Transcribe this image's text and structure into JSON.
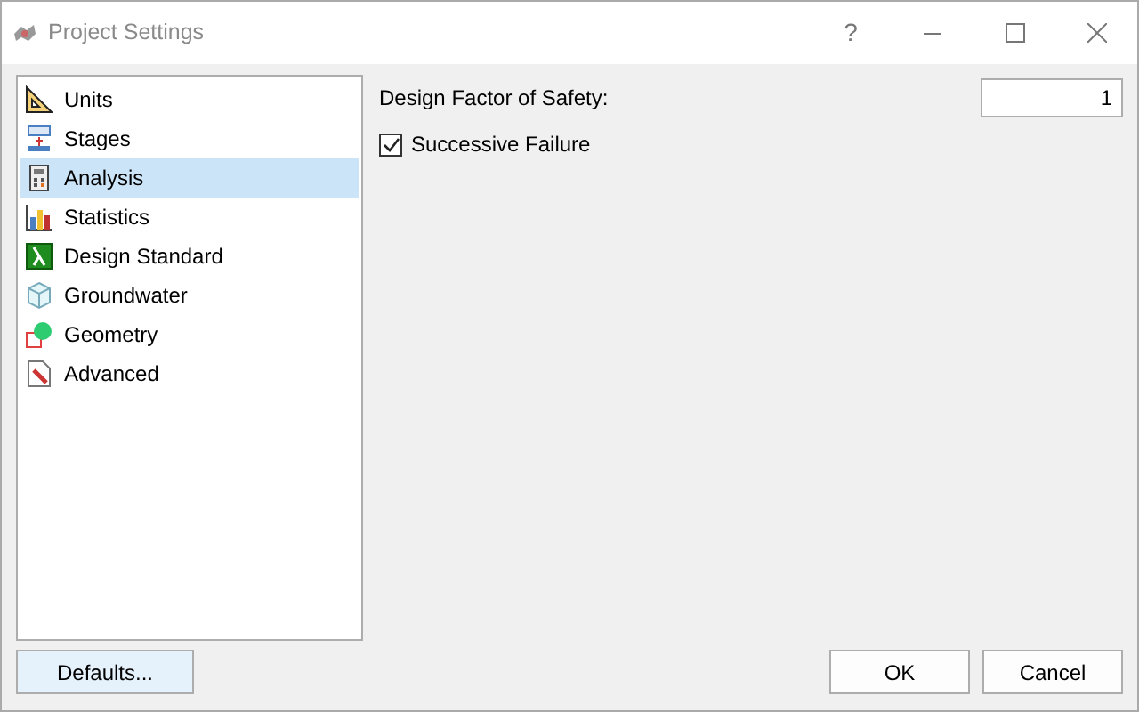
{
  "window": {
    "title": "Project Settings",
    "help": "?"
  },
  "sidebar": {
    "items": [
      {
        "label": "Units",
        "selected": false
      },
      {
        "label": "Stages",
        "selected": false
      },
      {
        "label": "Analysis",
        "selected": true
      },
      {
        "label": "Statistics",
        "selected": false
      },
      {
        "label": "Design Standard",
        "selected": false
      },
      {
        "label": "Groundwater",
        "selected": false
      },
      {
        "label": "Geometry",
        "selected": false
      },
      {
        "label": "Advanced",
        "selected": false
      }
    ]
  },
  "fields": [
    {
      "label": "Design Factor of Safety:",
      "value": "1"
    }
  ],
  "checkboxes": [
    {
      "label": "Successive Failure",
      "checked": true
    }
  ],
  "buttons": {
    "defaults": "Defaults...",
    "ok": "OK",
    "cancel": "Cancel"
  }
}
